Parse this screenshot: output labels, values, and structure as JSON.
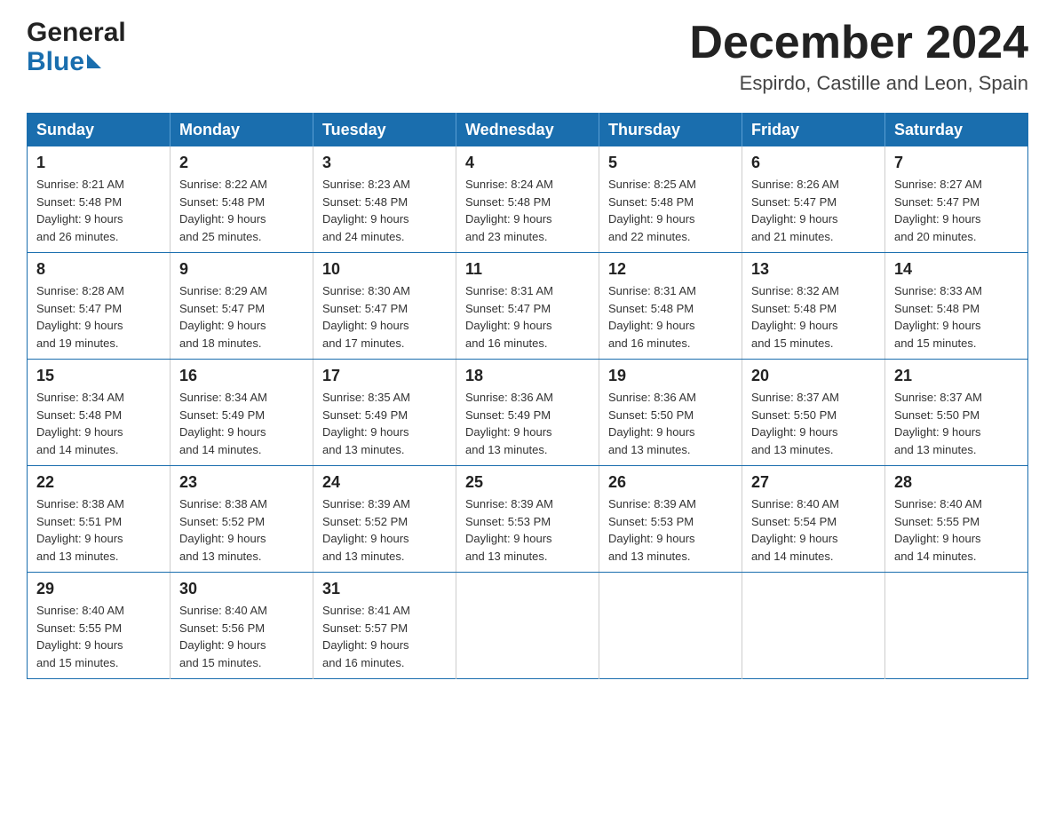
{
  "header": {
    "logo_general": "General",
    "logo_blue": "Blue",
    "title": "December 2024",
    "subtitle": "Espirdo, Castille and Leon, Spain"
  },
  "days_of_week": [
    "Sunday",
    "Monday",
    "Tuesday",
    "Wednesday",
    "Thursday",
    "Friday",
    "Saturday"
  ],
  "weeks": [
    [
      {
        "day": "1",
        "sunrise": "8:21 AM",
        "sunset": "5:48 PM",
        "daylight": "9 hours and 26 minutes."
      },
      {
        "day": "2",
        "sunrise": "8:22 AM",
        "sunset": "5:48 PM",
        "daylight": "9 hours and 25 minutes."
      },
      {
        "day": "3",
        "sunrise": "8:23 AM",
        "sunset": "5:48 PM",
        "daylight": "9 hours and 24 minutes."
      },
      {
        "day": "4",
        "sunrise": "8:24 AM",
        "sunset": "5:48 PM",
        "daylight": "9 hours and 23 minutes."
      },
      {
        "day": "5",
        "sunrise": "8:25 AM",
        "sunset": "5:48 PM",
        "daylight": "9 hours and 22 minutes."
      },
      {
        "day": "6",
        "sunrise": "8:26 AM",
        "sunset": "5:47 PM",
        "daylight": "9 hours and 21 minutes."
      },
      {
        "day": "7",
        "sunrise": "8:27 AM",
        "sunset": "5:47 PM",
        "daylight": "9 hours and 20 minutes."
      }
    ],
    [
      {
        "day": "8",
        "sunrise": "8:28 AM",
        "sunset": "5:47 PM",
        "daylight": "9 hours and 19 minutes."
      },
      {
        "day": "9",
        "sunrise": "8:29 AM",
        "sunset": "5:47 PM",
        "daylight": "9 hours and 18 minutes."
      },
      {
        "day": "10",
        "sunrise": "8:30 AM",
        "sunset": "5:47 PM",
        "daylight": "9 hours and 17 minutes."
      },
      {
        "day": "11",
        "sunrise": "8:31 AM",
        "sunset": "5:47 PM",
        "daylight": "9 hours and 16 minutes."
      },
      {
        "day": "12",
        "sunrise": "8:31 AM",
        "sunset": "5:48 PM",
        "daylight": "9 hours and 16 minutes."
      },
      {
        "day": "13",
        "sunrise": "8:32 AM",
        "sunset": "5:48 PM",
        "daylight": "9 hours and 15 minutes."
      },
      {
        "day": "14",
        "sunrise": "8:33 AM",
        "sunset": "5:48 PM",
        "daylight": "9 hours and 15 minutes."
      }
    ],
    [
      {
        "day": "15",
        "sunrise": "8:34 AM",
        "sunset": "5:48 PM",
        "daylight": "9 hours and 14 minutes."
      },
      {
        "day": "16",
        "sunrise": "8:34 AM",
        "sunset": "5:49 PM",
        "daylight": "9 hours and 14 minutes."
      },
      {
        "day": "17",
        "sunrise": "8:35 AM",
        "sunset": "5:49 PM",
        "daylight": "9 hours and 13 minutes."
      },
      {
        "day": "18",
        "sunrise": "8:36 AM",
        "sunset": "5:49 PM",
        "daylight": "9 hours and 13 minutes."
      },
      {
        "day": "19",
        "sunrise": "8:36 AM",
        "sunset": "5:50 PM",
        "daylight": "9 hours and 13 minutes."
      },
      {
        "day": "20",
        "sunrise": "8:37 AM",
        "sunset": "5:50 PM",
        "daylight": "9 hours and 13 minutes."
      },
      {
        "day": "21",
        "sunrise": "8:37 AM",
        "sunset": "5:50 PM",
        "daylight": "9 hours and 13 minutes."
      }
    ],
    [
      {
        "day": "22",
        "sunrise": "8:38 AM",
        "sunset": "5:51 PM",
        "daylight": "9 hours and 13 minutes."
      },
      {
        "day": "23",
        "sunrise": "8:38 AM",
        "sunset": "5:52 PM",
        "daylight": "9 hours and 13 minutes."
      },
      {
        "day": "24",
        "sunrise": "8:39 AM",
        "sunset": "5:52 PM",
        "daylight": "9 hours and 13 minutes."
      },
      {
        "day": "25",
        "sunrise": "8:39 AM",
        "sunset": "5:53 PM",
        "daylight": "9 hours and 13 minutes."
      },
      {
        "day": "26",
        "sunrise": "8:39 AM",
        "sunset": "5:53 PM",
        "daylight": "9 hours and 13 minutes."
      },
      {
        "day": "27",
        "sunrise": "8:40 AM",
        "sunset": "5:54 PM",
        "daylight": "9 hours and 14 minutes."
      },
      {
        "day": "28",
        "sunrise": "8:40 AM",
        "sunset": "5:55 PM",
        "daylight": "9 hours and 14 minutes."
      }
    ],
    [
      {
        "day": "29",
        "sunrise": "8:40 AM",
        "sunset": "5:55 PM",
        "daylight": "9 hours and 15 minutes."
      },
      {
        "day": "30",
        "sunrise": "8:40 AM",
        "sunset": "5:56 PM",
        "daylight": "9 hours and 15 minutes."
      },
      {
        "day": "31",
        "sunrise": "8:41 AM",
        "sunset": "5:57 PM",
        "daylight": "9 hours and 16 minutes."
      },
      null,
      null,
      null,
      null
    ]
  ],
  "labels": {
    "sunrise": "Sunrise:",
    "sunset": "Sunset:",
    "daylight": "Daylight:"
  }
}
